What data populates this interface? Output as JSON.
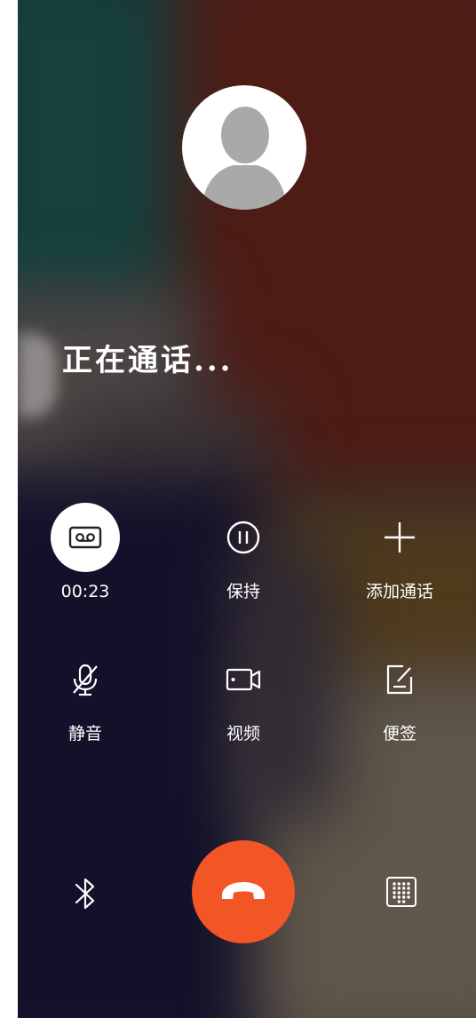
{
  "status_text": "正在通话...",
  "controls": [
    {
      "label": "00:23",
      "icon": "record-icon",
      "highlighted": true
    },
    {
      "label": "保持",
      "icon": "pause-icon"
    },
    {
      "label": "添加通话",
      "icon": "plus-icon"
    },
    {
      "label": "静音",
      "icon": "mic-off-icon"
    },
    {
      "label": "视频",
      "icon": "video-icon"
    },
    {
      "label": "便签",
      "icon": "note-icon"
    }
  ],
  "bottom_bar": {
    "left_icon": "bluetooth-icon",
    "center_icon": "end-call-icon",
    "right_icon": "dialpad-icon"
  },
  "colors": {
    "end_call": "#f25526",
    "text": "#ffffff"
  }
}
